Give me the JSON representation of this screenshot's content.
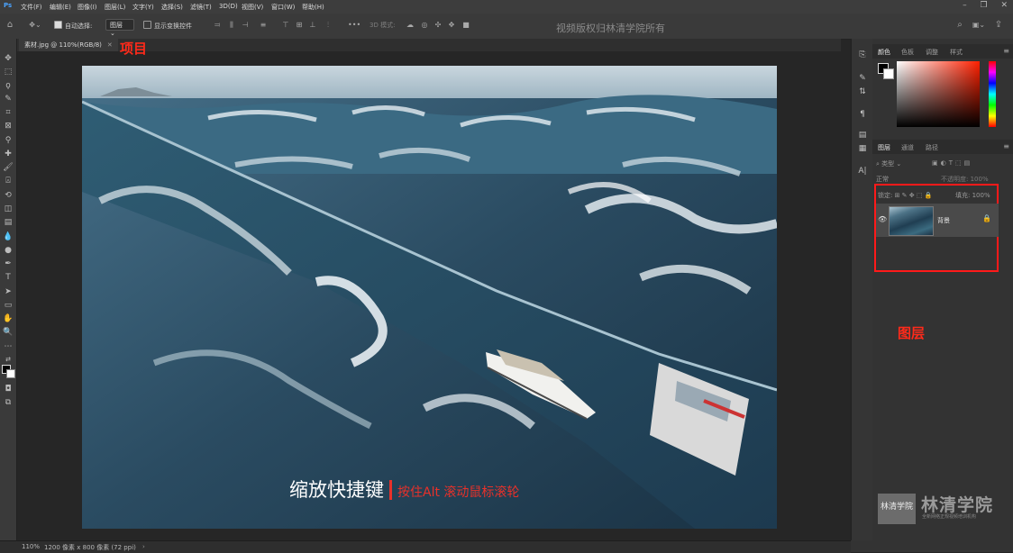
{
  "menu": [
    "文件(F)",
    "编辑(E)",
    "图像(I)",
    "图层(L)",
    "文字(Y)",
    "选择(S)",
    "滤镜(T)",
    "3D(D)",
    "视图(V)",
    "窗口(W)",
    "帮助(H)"
  ],
  "options": {
    "auto_select_label": "自动选择:",
    "auto_select_value": "图层",
    "show_transform_label": "显示变换控件",
    "mode_3d_label": "3D 模式:",
    "watermark": "视频版权归林清学院所有"
  },
  "document": {
    "tab_title": "素材.jpg @ 110%(RGB/8)",
    "caption_main": "缩放快捷键",
    "caption_sub": "按住Alt  滚动鼠标滚轮",
    "project_label": "项目"
  },
  "color_panel": {
    "tabs": [
      "颜色",
      "色板",
      "调整",
      "样式"
    ]
  },
  "layers_panel": {
    "tabs": [
      "图层",
      "通道",
      "路径"
    ],
    "filter_label": "类型",
    "blend_mode": "正常",
    "opacity_label": "不透明度:",
    "opacity_value": "100%",
    "lock_label": "锁定:",
    "fill_label": "填充:",
    "fill_value": "100%",
    "layer_name": "背景",
    "annotation": "图层"
  },
  "brand": {
    "mark": "林清学院",
    "name": "林清学院",
    "sub": "全新网络正规视频培训机构"
  },
  "status": {
    "zoom": "110%",
    "dims": "1200 像素 x 800 像素 (72 ppi)"
  },
  "colors": {
    "annotation_red": "#ff2a1a",
    "caption_red": "#e8312a",
    "panel_bg": "#333333"
  }
}
